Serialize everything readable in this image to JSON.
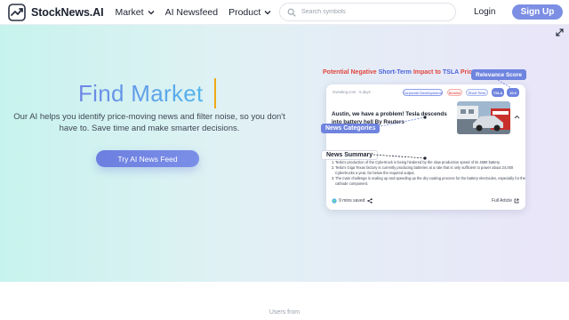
{
  "header": {
    "logo_text": "StockNews.AI",
    "nav": [
      {
        "label": "Market",
        "has_dropdown": true
      },
      {
        "label": "AI Newsfeed",
        "has_dropdown": false
      },
      {
        "label": "Product",
        "has_dropdown": true
      }
    ],
    "search_placeholder": "Search symbols",
    "login_label": "Login",
    "signup_label": "Sign Up"
  },
  "hero": {
    "title": "Find Market",
    "subtitle": "Our AI helps you identify price-moving news and filter noise, so you don't have to. Save time and make smarter decisions.",
    "cta_label": "Try AI News Feed"
  },
  "illustration": {
    "title_parts": {
      "p1": "Potential Negative",
      "p2": "Short-Term",
      "p3": "Impact to",
      "p4": "TSLA",
      "p5": "Price"
    },
    "relevance_label": "Relevance Score",
    "news_categories_label": "News Categories",
    "news_summary_label": "News Summary",
    "card": {
      "source": "investing.com · 5 days",
      "tags": {
        "corporate": "Corporate Developments",
        "bearish": "Bearish",
        "short_term": "Short Term",
        "ticker": "TSLA",
        "score": "10.0"
      },
      "headline": "Austin, we have a problem! Tesla descends into battery hell By Reuters",
      "summary_points": [
        {
          "num": "1.",
          "text": "Tesla's production of the Cybertruck is being hindered by the slow production speed of its 4680 battery."
        },
        {
          "num": "2.",
          "text": "Tesla's Giga Texas factory is currently producing batteries at a rate that is only sufficient to power about 24,000 Cybertrucks a year, far below the required output."
        },
        {
          "num": "3.",
          "text": "The main challenge is scaling up and speeding up the dry-coating process for the battery electrodes, especially for the cathode component."
        }
      ],
      "time_saved": "9 mins saved",
      "full_article_label": "Full Article"
    }
  },
  "footer": {
    "users_from_label": "Users from"
  },
  "colors": {
    "brand_accent": "#7c8fe4",
    "negative": "#e0463d",
    "highlight_blue": "#4a63d8",
    "caret": "#f0a817"
  },
  "icons": {
    "logo": "stocknews-logo-icon",
    "search": "search-icon",
    "dropdown": "chevron-down-icon",
    "expand": "expand-icon",
    "collapse": "chevron-up-icon",
    "share": "share-icon",
    "external_link": "external-link-icon"
  }
}
